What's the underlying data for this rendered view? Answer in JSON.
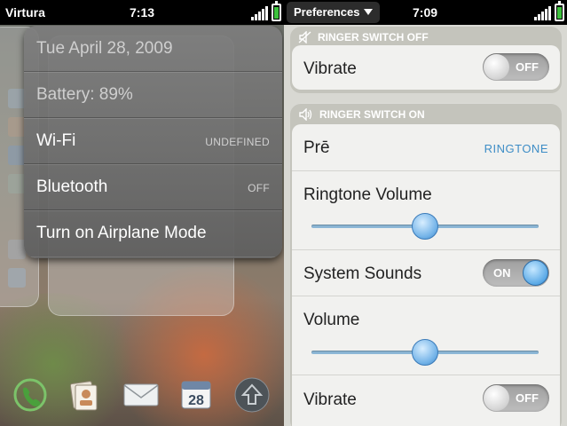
{
  "left_screen": {
    "status_bar": {
      "carrier": "Virtura",
      "time": "7:13"
    },
    "device_menu": {
      "date": "Tue April 28, 2009",
      "battery": "Battery: 89%",
      "items": [
        {
          "label": "Wi-Fi",
          "value": "UNDEFINED"
        },
        {
          "label": "Bluetooth",
          "value": "OFF"
        },
        {
          "label": "Turn on Airplane Mode",
          "value": ""
        }
      ]
    },
    "dock": {
      "icons": [
        "phone-icon",
        "contacts-icon",
        "email-icon",
        "calendar-icon",
        "launcher-icon"
      ],
      "calendar_day": "28"
    }
  },
  "right_screen": {
    "status_bar": {
      "app_menu": "Preferences",
      "time": "7:09"
    },
    "ringer_off": {
      "title": "RINGER SWITCH OFF",
      "vibrate": {
        "label": "Vibrate",
        "state": "OFF"
      }
    },
    "ringer_on": {
      "title": "RINGER SWITCH ON",
      "ringtone": {
        "label": "Prē",
        "value": "RINGTONE"
      },
      "ringtone_volume": {
        "label": "Ringtone Volume",
        "level": 0.5
      },
      "system_sounds": {
        "label": "System Sounds",
        "state": "ON"
      },
      "volume": {
        "label": "Volume",
        "level": 0.5
      },
      "vibrate": {
        "label": "Vibrate",
        "state": "OFF"
      }
    }
  },
  "colors": {
    "accent": "#3d8dc6",
    "battery": "#3ec13e",
    "panel": "#f1f1ef"
  }
}
